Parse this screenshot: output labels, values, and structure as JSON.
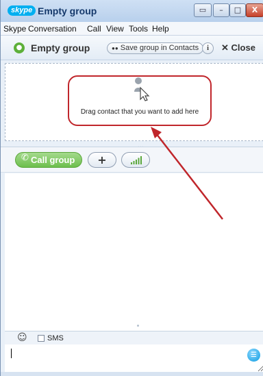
{
  "window": {
    "app_logo": "skype",
    "title": "Empty group",
    "controls": [
      "▭",
      "–",
      "□",
      "X"
    ]
  },
  "menu": {
    "items": [
      "Skype",
      "Conversation",
      "Call",
      "View",
      "Tools",
      "Help"
    ]
  },
  "header": {
    "group_title": "Empty group",
    "save_label": "Save group in Contacts",
    "info_label": "i",
    "close_label": "Close"
  },
  "dropzone": {
    "text": "Drag contact that you want to add here"
  },
  "call_toolbar": {
    "call_label": "Call group",
    "add_label": "+"
  },
  "input_toolbar": {
    "sms_label": "SMS"
  },
  "message": {
    "value": ""
  },
  "colors": {
    "accent": "#00aff0",
    "call_green": "#6dbf4d",
    "annotation_red": "#c0262b"
  },
  "icons": {
    "logo": "skype-logo",
    "group": "group-icon",
    "drag": "drag-contact-icon",
    "phone": "phone-icon",
    "signal": "signal-bars-icon",
    "emoticon": "smiley-icon",
    "send": "send-icon"
  }
}
